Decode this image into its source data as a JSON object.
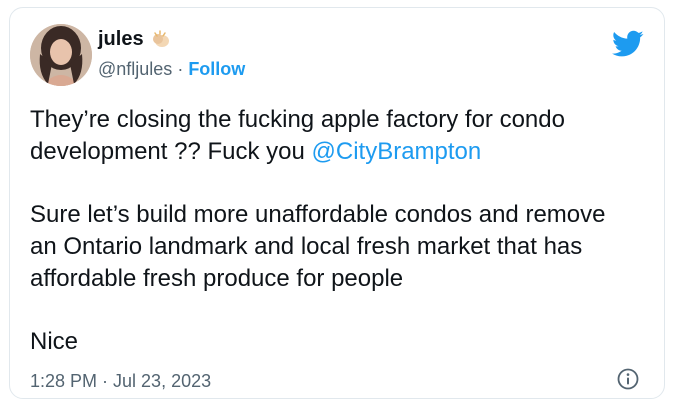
{
  "author": {
    "display_name": "jules",
    "badge_icon": "clapping-hands-icon",
    "handle": "@nfljules",
    "separator": "·",
    "follow_label": "Follow"
  },
  "platform_icon": "twitter-bird-icon",
  "tweet": {
    "line1_text": "They’re closing the fucking apple factory for condo development ?? Fuck you ",
    "mention": "@CityBrampton",
    "paragraph2": "Sure let’s build more unaffordable condos and remove an Ontario landmark and local fresh market that has affordable fresh produce for people",
    "paragraph3": "Nice"
  },
  "timestamp": "1:28 PM · Jul 23, 2023",
  "info_icon": "info-icon",
  "colors": {
    "accent": "#1d9bf0",
    "text": "#0f1419",
    "secondary": "#536471",
    "border": "#e1e8ed"
  }
}
